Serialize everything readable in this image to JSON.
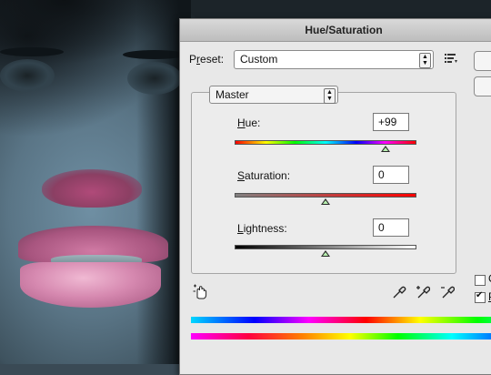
{
  "dialog": {
    "title": "Hue/Saturation",
    "preset": {
      "label_pre": "P",
      "label_u": "r",
      "label_post": "eset:",
      "value": "Custom"
    },
    "edit": {
      "value": "Master"
    },
    "hue": {
      "label_u": "H",
      "label_post": "ue:",
      "value": "+99",
      "level": 0.83
    },
    "saturation": {
      "label_u": "S",
      "label_post": "aturation:",
      "value": "0",
      "level": 0.5
    },
    "lightness": {
      "label_u": "L",
      "label_post": "ightness:",
      "value": "0",
      "level": 0.5
    },
    "checkbox_labels": {
      "colorize_initial": "C",
      "preview_initial": "P"
    },
    "colorize_checked": false,
    "preview_checked": true
  },
  "icons": {
    "preset_options": "list-options-icon",
    "targeted_adjustment": "hand-adjust-icon",
    "eyedropper": "eyedropper-icon",
    "eyedropper_plus": "eyedropper-plus-icon",
    "eyedropper_minus": "eyedropper-minus-icon",
    "spinner": "up-down-arrows-icon"
  }
}
